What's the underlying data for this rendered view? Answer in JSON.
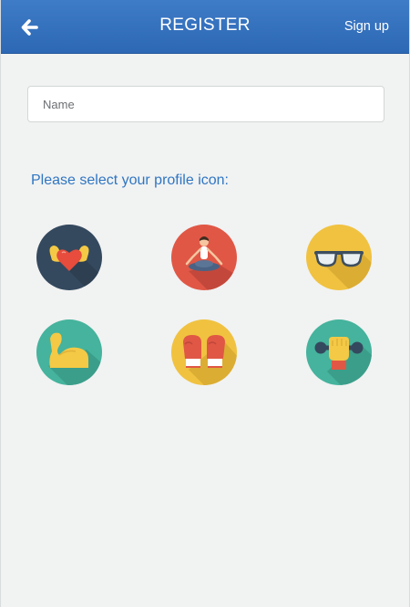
{
  "header": {
    "title": "REGISTER",
    "back_icon": "arrow-left-icon",
    "signup_label": "Sign up",
    "background_color": "#2f6db8"
  },
  "form": {
    "name_placeholder": "Name",
    "name_value": ""
  },
  "profile": {
    "prompt": "Please select your profile icon:",
    "prompt_color": "#2f76c2",
    "icons": [
      {
        "name": "heart-biceps-icon",
        "background": "#34495e"
      },
      {
        "name": "yoga-meditation-icon",
        "background": "#e05745"
      },
      {
        "name": "glasses-icon",
        "background": "#f0c240"
      },
      {
        "name": "flexed-arm-icon",
        "background": "#45b39d"
      },
      {
        "name": "boxing-gloves-icon",
        "background": "#f0c240"
      },
      {
        "name": "dumbbell-fist-icon",
        "background": "#45b39d"
      }
    ]
  }
}
